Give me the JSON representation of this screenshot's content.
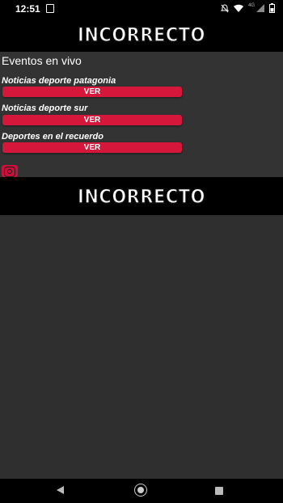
{
  "status_bar": {
    "time": "12:51",
    "network_label": "4G",
    "icons": [
      "notification-icon",
      "mute-icon",
      "wifi-icon",
      "signal-icon",
      "battery-icon"
    ]
  },
  "header": {
    "logo_text": "INCORRECTO"
  },
  "main": {
    "section_title": "Eventos en vivo",
    "items": [
      {
        "label": "Noticias deporte patagonia",
        "button_label": "VER"
      },
      {
        "label": "Noticias deporte sur",
        "button_label": "VER"
      },
      {
        "label": "Deportes en el recuerdo",
        "button_label": "VER"
      }
    ],
    "social_icon": "instagram-icon"
  },
  "banner": {
    "logo_text": "INCORRECTO"
  },
  "nav_bar": {
    "icons": [
      "back-icon",
      "home-icon",
      "recents-icon"
    ]
  },
  "colors": {
    "button": "#d4173a",
    "background": "#2f2f2f",
    "header": "#000000",
    "text": "#ffffff"
  }
}
